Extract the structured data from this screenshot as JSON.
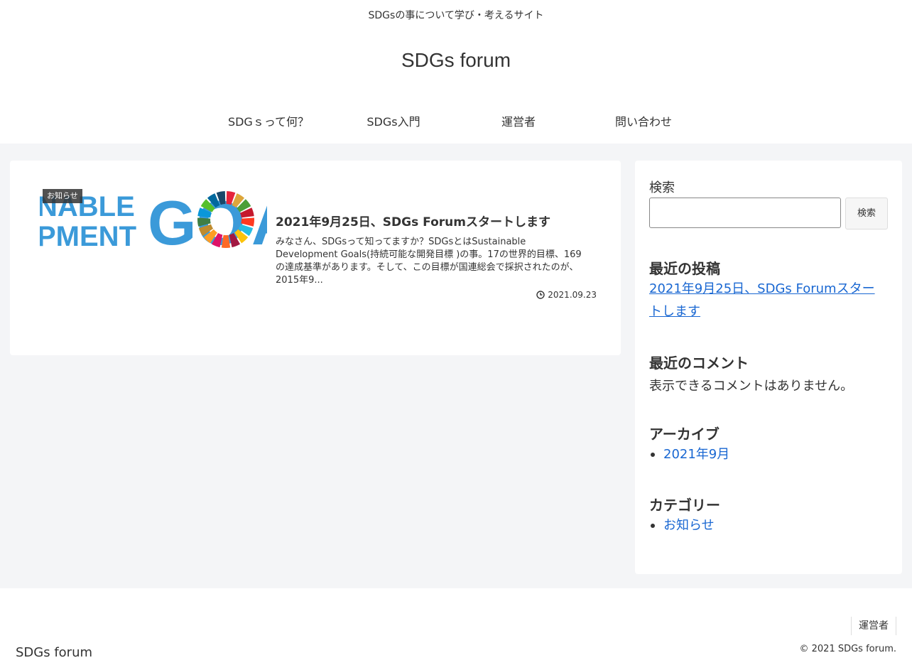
{
  "header": {
    "tagline": "SDGsの事について学び・考えるサイト",
    "site_title": "SDGs forum",
    "nav": [
      {
        "label": "SDGｓって何？"
      },
      {
        "label": "SDGs入門"
      },
      {
        "label": "運営者"
      },
      {
        "label": "問い合わせ"
      }
    ]
  },
  "entry": {
    "category": "お知らせ",
    "title": "2021年9月25日、SDGs Forumスタートします",
    "snippet": "みなさん、SDGsって知ってますか？SDGsとはSustainable Development Goals(持続可能な開発目標 )の事。17の世界的目標、169の達成基準があります。そして、この目標が国連総会で採択されたのが、2015年9...",
    "date": "2021.09.23",
    "thumb": {
      "line1": "NABLE",
      "line2": "PMENT",
      "goals": "GO",
      "wheel_colors": [
        "#e5243b",
        "#dda63a",
        "#4c9f38",
        "#c5192d",
        "#ff3a21",
        "#26bde2",
        "#fcc30b",
        "#a21942",
        "#fd6925",
        "#dd1367",
        "#fd9d24",
        "#bf8b2e",
        "#3f7e44",
        "#0a97d9",
        "#56c02b",
        "#00689d",
        "#19486a"
      ],
      "text_color": "#3b9ad9"
    }
  },
  "sidebar": {
    "search_label": "検索",
    "search_value": "",
    "search_button": "検索",
    "recent_posts_heading": "最近の投稿",
    "recent_posts": [
      {
        "label": "2021年9月25日、SDGs Forumスタートします"
      }
    ],
    "recent_comments_heading": "最近のコメント",
    "recent_comments_text": "表示できるコメントはありません。",
    "archives_heading": "アーカイブ",
    "archives": [
      {
        "label": "2021年9月"
      }
    ],
    "categories_heading": "カテゴリー",
    "categories": [
      {
        "label": "お知らせ"
      }
    ]
  },
  "footer": {
    "nav_item": "運営者",
    "site_title": "SDGs forum",
    "copyright": "© 2021 SDGs forum."
  },
  "colors": {
    "background": "#f4f5f7",
    "card": "#ffffff",
    "link": "#1967d2",
    "text": "#333333"
  }
}
